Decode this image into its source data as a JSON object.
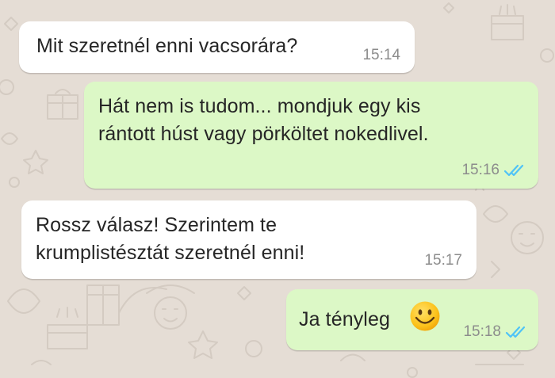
{
  "chat": {
    "wallpaper_color": "#e5ddd5",
    "incoming_bubble_color": "#ffffff",
    "outgoing_bubble_color": "#dcf8c6",
    "read_receipt_color": "#4fc3f7",
    "messages": [
      {
        "direction": "incoming",
        "text": "Mit szeretnél enni vacsorára?",
        "time": "15:14"
      },
      {
        "direction": "outgoing",
        "text": "Hát nem is tudom... mondjuk egy kis\nrántott húst vagy pörköltet nokedlivel.",
        "time": "15:16",
        "status_icon": "double-check-read-icon"
      },
      {
        "direction": "incoming",
        "text": "Rossz válasz! Szerintem te\nkrumplistésztát szeretnél enni!",
        "time": "15:17"
      },
      {
        "direction": "outgoing",
        "text": "Ja tényleg",
        "emoji": "smiling-face-icon",
        "time": "15:18",
        "status_icon": "double-check-read-icon"
      }
    ]
  }
}
